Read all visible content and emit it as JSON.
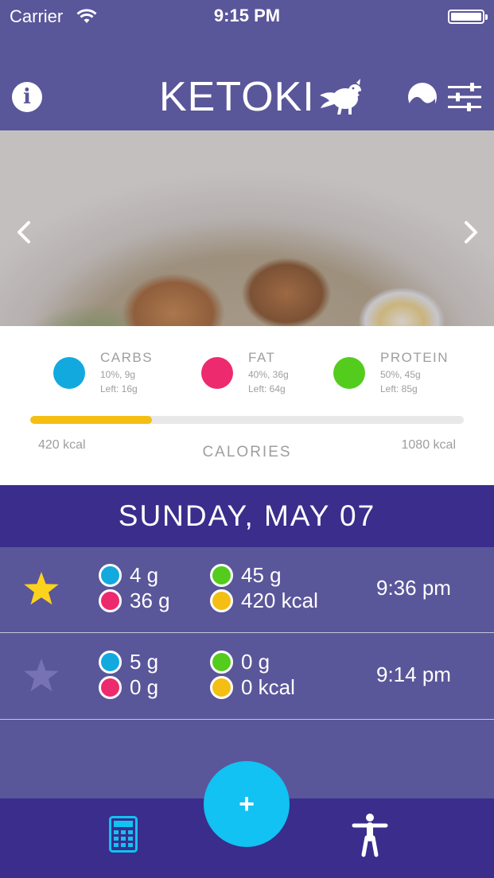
{
  "status": {
    "carrier": "Carrier",
    "time": "9:15 PM"
  },
  "header": {
    "info_label": "i",
    "logo_text": "KETOKI"
  },
  "colors": {
    "carbs": "#12a9df",
    "fat": "#ee2a6f",
    "protein": "#54cc1e",
    "calories": "#f5be12",
    "header": "#3a2d8c",
    "panel": "#5a569a",
    "fab": "#11c2f2"
  },
  "macros": [
    {
      "name": "CARBS",
      "detail": "10%, 9g",
      "left": "Left: 16g",
      "color": "#12a9df"
    },
    {
      "name": "FAT",
      "detail": "40%, 36g",
      "left": "Left: 64g",
      "color": "#ee2a6f"
    },
    {
      "name": "PROTEIN",
      "detail": "50%, 45g",
      "left": "Left: 85g",
      "color": "#54cc1e"
    }
  ],
  "calories": {
    "consumed": "420 kcal",
    "label": "CALORIES",
    "goal": "1080 kcal",
    "progress_fraction": 0.28
  },
  "day": {
    "label": "SUNDAY, MAY 07"
  },
  "entries": [
    {
      "favorite": true,
      "carbs": "4 g",
      "fat": "36 g",
      "protein": "45 g",
      "calories": "420 kcal",
      "time": "9:36 pm"
    },
    {
      "favorite": false,
      "carbs": "5 g",
      "fat": "0 g",
      "protein": "0 g",
      "calories": "0 kcal",
      "time": "9:14 pm"
    }
  ],
  "fab": {
    "label": "+"
  },
  "icons": {
    "info": "info-icon",
    "logo": "pig-wing-icon",
    "theme": "theme-icon",
    "filter": "sliders-icon",
    "prev": "chevron-left-icon",
    "next": "chevron-right-icon",
    "favorite": "star-icon",
    "calculator": "calculator-icon",
    "body": "body-icon"
  }
}
